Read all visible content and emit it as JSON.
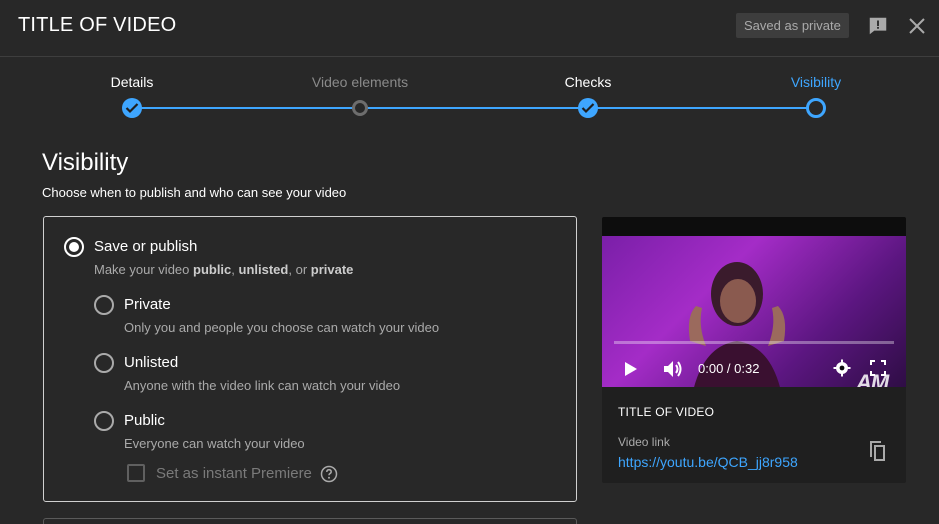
{
  "header": {
    "title": "TITLE OF VIDEO",
    "saved_badge": "Saved as private",
    "feedback_icon": "feedback-icon",
    "close_icon": "close-icon"
  },
  "stepper": {
    "steps": [
      {
        "label": "Details",
        "state": "done"
      },
      {
        "label": "Video elements",
        "state": "inactive"
      },
      {
        "label": "Checks",
        "state": "done"
      },
      {
        "label": "Visibility",
        "state": "active"
      }
    ]
  },
  "visibility": {
    "title": "Visibility",
    "subtitle": "Choose when to publish and who can see your video",
    "save_or_publish": {
      "label": "Save or publish",
      "desc_prefix": "Make your video ",
      "desc_public": "public",
      "desc_sep1": ", ",
      "desc_unlisted": "unlisted",
      "desc_sep2": ", or ",
      "desc_private": "private",
      "selected": true
    },
    "options": [
      {
        "label": "Private",
        "desc": "Only you and people you choose can watch your video"
      },
      {
        "label": "Unlisted",
        "desc": "Anyone with the video link can watch your video"
      },
      {
        "label": "Public",
        "desc": "Everyone can watch your video"
      }
    ],
    "premiere_label": "Set as instant Premiere"
  },
  "preview": {
    "time": "0:00 / 0:32",
    "watermark": "AM",
    "title": "TITLE OF VIDEO",
    "link_caption": "Video link",
    "link_url": "https://youtu.be/QCB_jj8r958"
  },
  "colors": {
    "accent": "#3ea6ff",
    "background": "#282828",
    "card": "#1f1f1f"
  }
}
